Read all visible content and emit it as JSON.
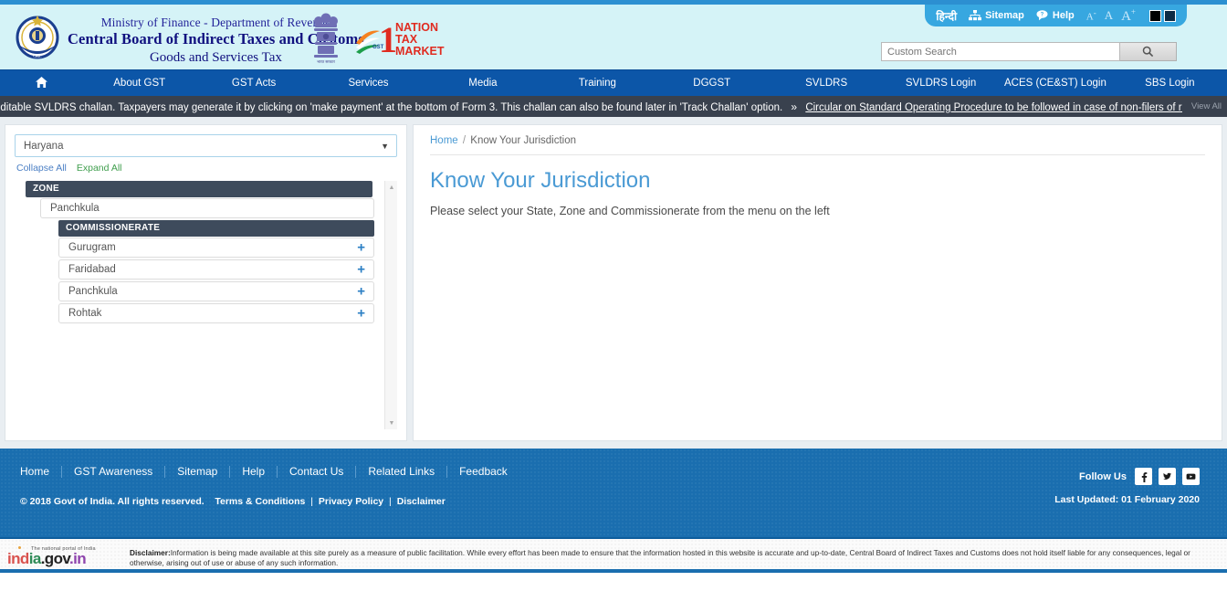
{
  "header": {
    "ministry_line": "Ministry of Finance - Department of Revenue",
    "board_line": "Central Board of Indirect Taxes and Customs",
    "tax_line": "Goods and Services Tax",
    "gst_logo": {
      "numeral": "1",
      "gst": "GST",
      "line1": "NATION",
      "line2": "TAX",
      "line3": "MARKET"
    }
  },
  "utility": {
    "hindi": "हिन्दी",
    "sitemap": "Sitemap",
    "help": "Help",
    "font_decrease": "A",
    "font_decrease_sup": "-",
    "font_normal": "A",
    "font_increase": "A",
    "font_increase_sup": "+",
    "contrast_black": "#000000",
    "contrast_navy": "#0d2b45"
  },
  "search": {
    "placeholder": "Custom Search",
    "value": "",
    "icon": "search-icon"
  },
  "nav": {
    "home_icon": "home-icon",
    "items": [
      {
        "label": "About GST"
      },
      {
        "label": "GST Acts"
      },
      {
        "label": "Services"
      },
      {
        "label": "Media"
      },
      {
        "label": "Training"
      },
      {
        "label": "DGGST"
      },
      {
        "label": "SVLDRS"
      },
      {
        "label": "SVLDRS Login"
      },
      {
        "label": "ACES (CE&ST) Login"
      },
      {
        "label": "SBS Login"
      }
    ]
  },
  "ticker": {
    "text": "editable SVLDRS challan. Taxpayers may generate it by clicking on 'make payment' at the bottom of Form 3. This challan can also be found later in 'Track Challan' option.",
    "separator": "»",
    "link": "Circular on Standard Operating Procedure to be followed in case of non-filers of returr",
    "view_all": "View All"
  },
  "sidebar": {
    "state_selected": "Haryana",
    "collapse_all": "Collapse All",
    "expand_all": "Expand All",
    "zone_header": "ZONE",
    "zone_name": "Panchkula",
    "commissionerate_header": "COMMISSIONERATE",
    "commissionerates": [
      {
        "name": "Gurugram",
        "expand": "+"
      },
      {
        "name": "Faridabad",
        "expand": "+"
      },
      {
        "name": "Panchkula",
        "expand": "+"
      },
      {
        "name": "Rohtak",
        "expand": "+"
      }
    ]
  },
  "main": {
    "breadcrumb_home": "Home",
    "breadcrumb_sep": "/",
    "breadcrumb_current": "Know Your Jurisdiction",
    "title": "Know Your Jurisdiction",
    "subtitle": "Please select your State, Zone and Commissionerate from the menu on the left"
  },
  "footer": {
    "links": [
      {
        "label": "Home"
      },
      {
        "label": "GST Awareness"
      },
      {
        "label": "Sitemap"
      },
      {
        "label": "Help"
      },
      {
        "label": "Contact Us"
      },
      {
        "label": "Related Links"
      },
      {
        "label": "Feedback"
      }
    ],
    "copyright": "© 2018 Govt of India. All rights reserved.",
    "terms": "Terms & Conditions",
    "privacy": "Privacy Policy",
    "disclaimer_link": "Disclaimer",
    "follow_label": "Follow Us",
    "social": [
      "facebook-icon",
      "twitter-icon",
      "youtube-icon"
    ],
    "last_updated": "Last Updated: 01 February 2020"
  },
  "disclaimer": {
    "logo_tagline": "The national portal of India",
    "logo_ind": "ind",
    "logo_ia": "ia",
    "logo_gov": ".gov",
    "logo_in": ".in",
    "label": "Disclaimer:",
    "text": "Information is being made available at this site purely as a measure of public facilitation. While every effort has been made to ensure that the information hosted in this website is accurate and up-to-date, Central Board of Indirect Taxes and Customs does not hold itself liable for any consequences, legal or otherwise, arising out of use or abuse of any such information."
  }
}
